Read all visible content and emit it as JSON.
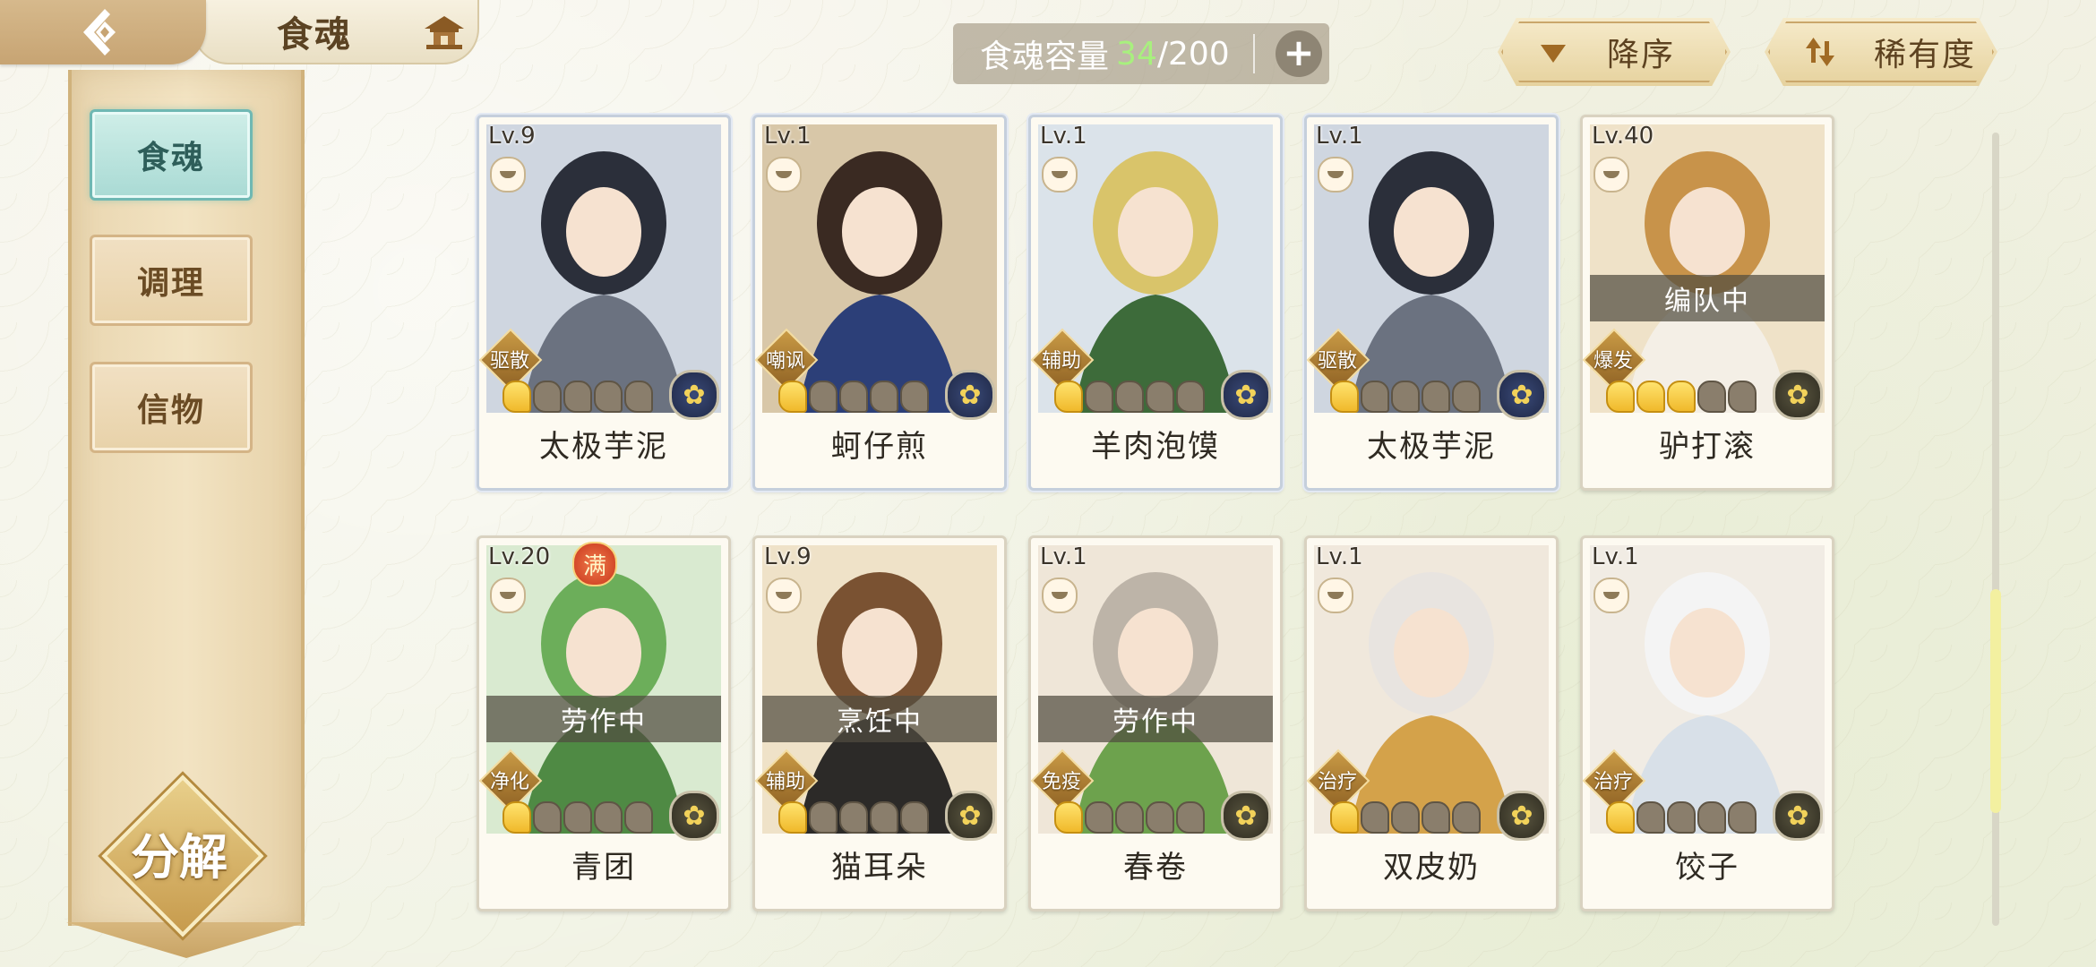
{
  "header": {
    "title": "食魂"
  },
  "sidebar": {
    "items": [
      {
        "label": "食魂",
        "active": true
      },
      {
        "label": "调理",
        "active": false
      },
      {
        "label": "信物",
        "active": false
      }
    ],
    "decompose_label": "分解"
  },
  "capacity": {
    "label": "食魂容量",
    "current": "34",
    "total": "/200"
  },
  "sort": {
    "order_label": "降序",
    "rarity_label": "稀有度"
  },
  "cards": [
    {
      "level": "Lv.9",
      "role": "驱散",
      "name": "太极芋泥",
      "stars": 1,
      "status": ""
    },
    {
      "level": "Lv.1",
      "role": "嘲讽",
      "name": "蚵仔煎",
      "stars": 1,
      "status": ""
    },
    {
      "level": "Lv.1",
      "role": "辅助",
      "name": "羊肉泡馍",
      "stars": 1,
      "status": ""
    },
    {
      "level": "Lv.1",
      "role": "驱散",
      "name": "太极芋泥",
      "stars": 1,
      "status": ""
    },
    {
      "level": "Lv.40",
      "role": "爆发",
      "name": "驴打滚",
      "stars": 3,
      "status": "编队中"
    },
    {
      "level": "Lv.20",
      "role": "净化",
      "name": "青团",
      "stars": 1,
      "status": "劳作中",
      "badge": "满"
    },
    {
      "level": "Lv.9",
      "role": "辅助",
      "name": "猫耳朵",
      "stars": 1,
      "status": "烹饪中"
    },
    {
      "level": "Lv.1",
      "role": "免疫",
      "name": "春卷",
      "stars": 1,
      "status": "劳作中"
    },
    {
      "level": "Lv.1",
      "role": "治疗",
      "name": "双皮奶",
      "stars": 1,
      "status": ""
    },
    {
      "level": "Lv.1",
      "role": "治疗",
      "name": "饺子",
      "stars": 1,
      "status": ""
    }
  ],
  "colors": {
    "accent_green": "#a8f07e",
    "active_tab": "#a9dad4",
    "gold": "#c79b4d"
  }
}
